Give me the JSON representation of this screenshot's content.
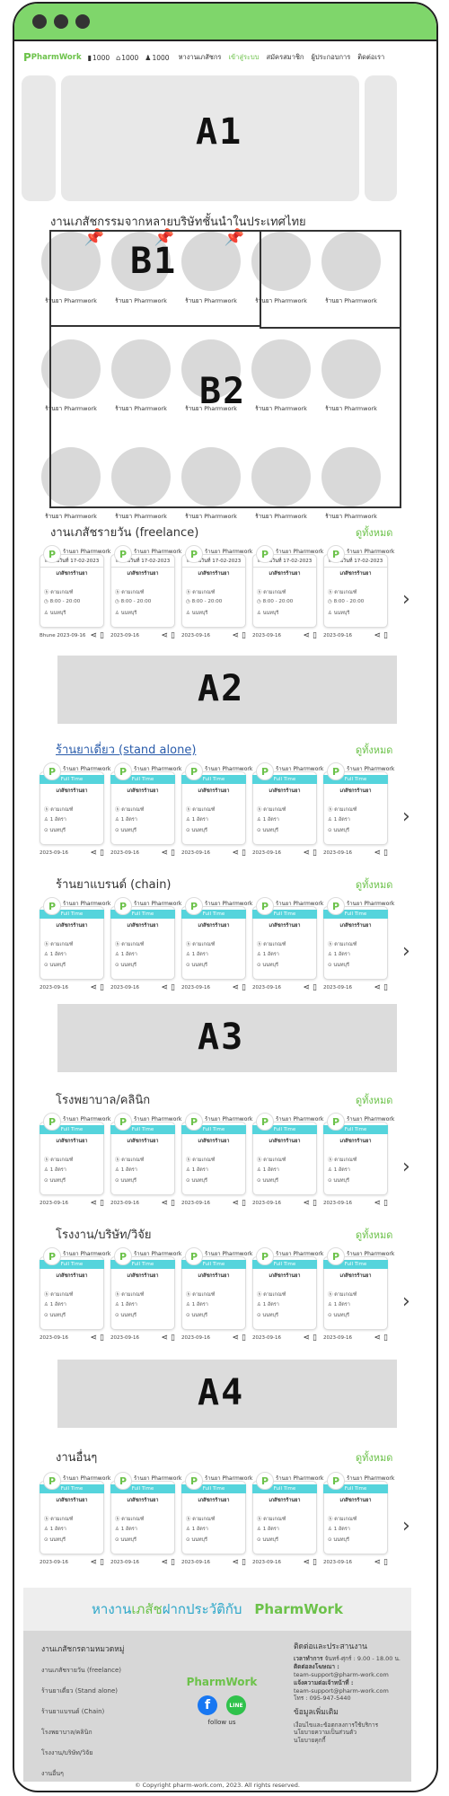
{
  "nav": {
    "logo": "PharmWork",
    "stats": [
      "1000",
      "1000",
      "1000"
    ],
    "links": [
      "หางานเภสัชกร",
      "เข้าสู่ระบบ",
      "สมัครสมาชิก",
      "ผู้ประกอบการ",
      "ติดต่อเรา"
    ],
    "active_link": "เข้าสู่ระบบ"
  },
  "placeholders": {
    "a1": "A1",
    "a2": "A2",
    "a3": "A3",
    "a4": "A4",
    "b1": "B1",
    "b2": "B2"
  },
  "brands": {
    "title": "งานเภสัชกรรมจากหลายบริษัทชั้นนำในประเทศไทย",
    "label": "ร้านยา Pharmwork",
    "count": 15
  },
  "see_all": "ดูทั้งหมด",
  "freelance": {
    "title": "งานเภสัชรายวัน (freelance)",
    "cards": [
      {
        "store": "ร้านยา Pharmwork",
        "date": "ทำงานวันที่ 17-02-2023",
        "title": "เภสัชกรร้านยา",
        "wage": "ตามเกณฑ์",
        "time": "8:00 - 20:00",
        "loc": "นนทบุรี",
        "posted": "Bhune 2023-09-16"
      },
      {
        "store": "ร้านยา Pharmwork",
        "date": "ทำงานวันที่ 17-02-2023",
        "title": "เภสัชกรร้านยา",
        "wage": "ตามเกณฑ์",
        "time": "8:00 - 20:00",
        "loc": "นนทบุรี",
        "posted": "2023-09-16"
      },
      {
        "store": "ร้านยา Pharmwork",
        "date": "ทำงานวันที่ 17-02-2023",
        "title": "เภสัชกรร้านยา",
        "wage": "ตามเกณฑ์",
        "time": "8:00 - 20:00",
        "loc": "นนทบุรี",
        "posted": "2023-09-16"
      },
      {
        "store": "ร้านยา Pharmwork",
        "date": "ทำงานวันที่ 17-02-2023",
        "title": "เภสัชกรร้านยา",
        "wage": "ตามเกณฑ์",
        "time": "8:00 - 20:00",
        "loc": "นนทบุรี",
        "posted": "2023-09-16"
      },
      {
        "store": "ร้านยา Pharmwork",
        "date": "ทำงานวันที่ 17-02-2023",
        "title": "เภสัชกรร้านยา",
        "wage": "ตามเกณฑ์",
        "time": "8:00 - 20:00",
        "loc": "นนทบุรี",
        "posted": "2023-09-16"
      }
    ]
  },
  "fulltime_card": {
    "store": "ร้านยา Pharmwork",
    "band": "Full Time",
    "title": "เภสัชกรร้านยา",
    "wage": "ตามเกณฑ์",
    "count": "1 อัตรา",
    "loc": "นนทบุรี",
    "posted": "2023-09-16"
  },
  "sections": [
    {
      "title": "ร้านยาเดี่ยว (stand alone)"
    },
    {
      "title": "ร้านยาแบรนด์ (chain)"
    },
    {
      "title": "โรงพยาบาล/คลินิก"
    },
    {
      "title": "โรงงาน/บริษัท/วิจัย"
    },
    {
      "title": "งานอื่นๆ"
    }
  ],
  "footer": {
    "banner_text_a": "หางาน",
    "banner_text_b": "เภสัช",
    "banner_text_c": "ฝากประวัติกับ",
    "banner_logo": "PharmWork",
    "col1_title": "งานเภสัชกรตามหมวดหมู่",
    "col1_items": [
      "งานเภสัชรายวัน (freelance)",
      "ร้านยาเดี่ยว (Stand alone)",
      "ร้านยาแบรนด์ (Chain)",
      "โรงพยาบาล/คลินิก",
      "โรงงาน/บริษัท/วิจัย",
      "งานอื่นๆ"
    ],
    "mid_logo": "PharmWork",
    "follow": "follow us",
    "col3_title": "ติดต่อและประสานงาน",
    "hours_label": "เวลาทำการ",
    "hours": "จันทร์-ศุกร์ : 9.00 - 18.00 น.",
    "ads_label": "ติดต่อลงโฆษณา :",
    "ads_email": "team-support@pharm-work.com",
    "report_label": "แจ้งความต่อเจ้าหน้าที่ :",
    "report_email": "team-support@pharm-work.com",
    "tel": "โทร : 095-947-5440",
    "more_title": "ข้อมูลเพิ่มเติม",
    "more_items": [
      "เงื่อนไขและข้อตกลงการใช้บริการ",
      "นโยบายความเป็นส่วนตัว",
      "นโยบายคุกกี้"
    ],
    "copyright": "© Copyright pharm-work.com, 2023. All rights reserved."
  }
}
